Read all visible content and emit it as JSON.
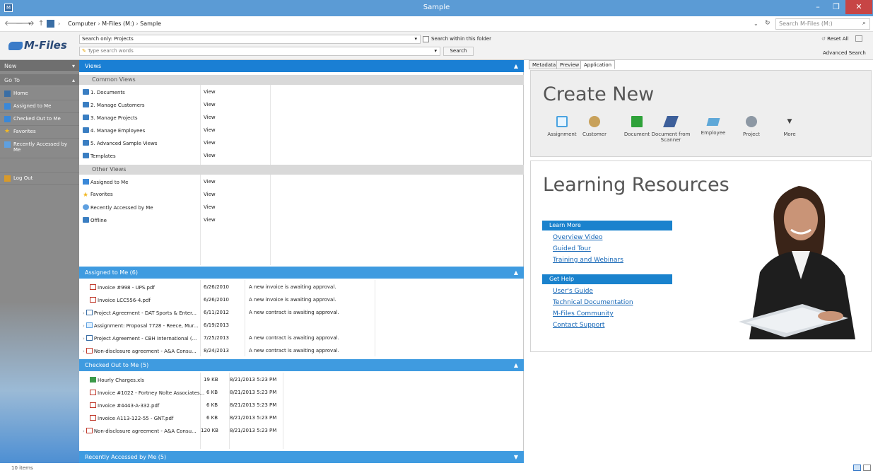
{
  "window": {
    "title": "Sample",
    "app_icon_label": "M",
    "minimize": "–",
    "maximize": "❐",
    "close": "✕"
  },
  "address": {
    "back": "🡐",
    "forward": "🡒",
    "dropdown": "▾",
    "up": "↑",
    "breadcrumbs": [
      "Computer",
      "M-Files (M:)",
      "Sample"
    ],
    "search_placeholder": "Search M-Files (M:)"
  },
  "toolbar": {
    "logo_text": "M-Files",
    "search_only_label": "Search only: Projects",
    "search_within_label": "Search within this folder",
    "search_placeholder": "Type search words",
    "search_button": "Search",
    "reset_all": "Reset All",
    "advanced_search": "Advanced Search"
  },
  "left_panel": {
    "new_label": "New",
    "goto_label": "Go To",
    "items": [
      {
        "label": "Home",
        "color": "#3a6ea5"
      },
      {
        "label": "Assigned to Me",
        "color": "#3a88d8"
      },
      {
        "label": "Checked Out to Me",
        "color": "#3a88d8"
      },
      {
        "label": "Favorites",
        "color": "#f2b824"
      },
      {
        "label": "Recently Accessed by Me",
        "color": "#5fa0e0"
      }
    ],
    "logout_label": "Log Out"
  },
  "views": {
    "header": "Views",
    "common_views_label": "Common Views",
    "common_views": [
      {
        "name": "1. Documents",
        "type": "View"
      },
      {
        "name": "2. Manage Customers",
        "type": "View"
      },
      {
        "name": "3. Manage Projects",
        "type": "View"
      },
      {
        "name": "4. Manage Employees",
        "type": "View"
      },
      {
        "name": "5. Advanced Sample Views",
        "type": "View"
      },
      {
        "name": "Templates",
        "type": "View"
      }
    ],
    "other_views_label": "Other Views",
    "other_views": [
      {
        "name": "Assigned to Me",
        "type": "View"
      },
      {
        "name": "Favorites",
        "type": "View"
      },
      {
        "name": "Recently Accessed by Me",
        "type": "View"
      },
      {
        "name": "Offline",
        "type": "View"
      }
    ]
  },
  "assigned": {
    "header": "Assigned to Me (6)",
    "rows": [
      {
        "name": "Invoice #998 - UPS.pdf",
        "date": "6/26/2010",
        "desc": "A new invoice is awaiting approval.",
        "expandable": false
      },
      {
        "name": "Invoice LCC556-4.pdf",
        "date": "6/26/2010",
        "desc": "A new invoice is awaiting approval.",
        "expandable": false
      },
      {
        "name": "Project Agreement - DAT Sports & Enter...",
        "date": "6/11/2012",
        "desc": "A new contract is awaiting approval.",
        "expandable": true
      },
      {
        "name": "Assignment: Proposal 7728 - Reece, Mur...",
        "date": "6/19/2013",
        "desc": "",
        "expandable": true
      },
      {
        "name": "Project Agreement - CBH International (...",
        "date": "7/25/2013",
        "desc": "A new contract is awaiting approval.",
        "expandable": true
      },
      {
        "name": "Non-disclosure agreement - A&A Consu...",
        "date": "8/24/2013",
        "desc": "A new contract is awaiting approval.",
        "expandable": true
      }
    ]
  },
  "checked_out": {
    "header": "Checked Out to Me (5)",
    "rows": [
      {
        "name": "Hourly Charges.xls",
        "size": "19 KB",
        "date": "8/21/2013 5:23 PM",
        "expandable": false
      },
      {
        "name": "Invoice #1022 - Fortney Nolte Associates...",
        "size": "6 KB",
        "date": "8/21/2013 5:23 PM",
        "expandable": false
      },
      {
        "name": "Invoice #4443-A-332.pdf",
        "size": "6 KB",
        "date": "8/21/2013 5:23 PM",
        "expandable": false
      },
      {
        "name": "Invoice A113-122-55 - GNT.pdf",
        "size": "6 KB",
        "date": "8/21/2013 5:23 PM",
        "expandable": false
      },
      {
        "name": "Non-disclosure agreement - A&A Consu...",
        "size": "120 KB",
        "date": "8/21/2013 5:23 PM",
        "expandable": true
      }
    ]
  },
  "recent": {
    "header": "Recently Accessed by Me (5)"
  },
  "right_panel": {
    "tabs": [
      "Metadata",
      "Preview",
      "Application"
    ],
    "active_tab": "Application",
    "create_new_title": "Create New",
    "create_items": [
      {
        "label": "Assignment",
        "icon": "assignment-icon"
      },
      {
        "label": "Customer",
        "icon": "customer-icon"
      },
      {
        "label": "Document",
        "icon": "document-icon"
      },
      {
        "label": "Document from Scanner",
        "icon": "scanner-icon"
      },
      {
        "label": "Employee",
        "icon": "employee-icon"
      },
      {
        "label": "Project",
        "icon": "project-icon"
      },
      {
        "label": "More",
        "icon": "chevron-down-icon"
      }
    ],
    "learning_title": "Learning Resources",
    "learn_more_label": "Learn More",
    "learn_more_links": [
      "Overview Video",
      "Guided Tour",
      "Training and Webinars"
    ],
    "get_help_label": "Get Help",
    "get_help_links": [
      "User's Guide",
      "Technical Documentation",
      "M-Files Community",
      "Contact Support"
    ]
  },
  "status": {
    "items_count": "10 items"
  },
  "colors": {
    "section_blue": "#3f9be0",
    "views_blue": "#1a7fd4",
    "learn_bar": "#1a82cd",
    "link_blue": "#1466b6"
  }
}
